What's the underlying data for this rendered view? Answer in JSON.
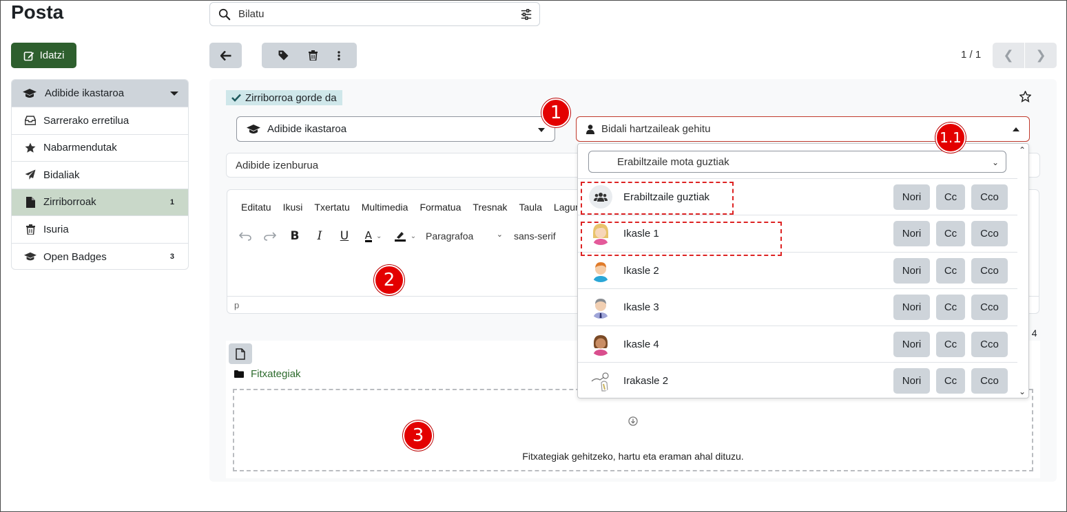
{
  "app": {
    "title": "Posta"
  },
  "search": {
    "placeholder": "Bilatu"
  },
  "compose": {
    "label": "Idatzi"
  },
  "sidebar": {
    "header": "Adibide ikastaroa",
    "items": [
      {
        "label": "Sarrerako erretilua",
        "icon": "inbox-icon",
        "count": ""
      },
      {
        "label": "Nabarmendutak",
        "icon": "star-icon",
        "count": ""
      },
      {
        "label": "Bidaliak",
        "icon": "send-icon",
        "count": ""
      },
      {
        "label": "Zirriborroak",
        "icon": "file-icon",
        "count": "1",
        "active": true
      },
      {
        "label": "Isuria",
        "icon": "trash-icon",
        "count": ""
      },
      {
        "label": "Open Badges",
        "icon": "graduation-cap-icon",
        "count": "3"
      }
    ]
  },
  "pager": {
    "text": "1 / 1"
  },
  "draft": {
    "saved_status": "Zirriborroa gorde da",
    "course": "Adibide ikastaroa",
    "recipients_placeholder": "Bidali hartzaileak gehitu",
    "subject": "Adibide izenburua"
  },
  "editor": {
    "menu": [
      "Editatu",
      "Ikusi",
      "Txertatu",
      "Multimedia",
      "Formatua",
      "Tresnak",
      "Taula",
      "Lagunt"
    ],
    "block_format": "Paragrafoa",
    "font_family": "sans-serif",
    "status_path": "p"
  },
  "right_count": ": 4",
  "files": {
    "folder": "Fitxategiak",
    "dropzone_text": "Fitxategiak gehitzeko, hartu eta eraman ahal dituzu."
  },
  "recipients_dropdown": {
    "filter": "Erabiltzaile mota guztiak",
    "buttons": {
      "to": "Nori",
      "cc": "Cc",
      "bcc": "Cco"
    },
    "rows": [
      {
        "name": "Erabiltzaile guztiak",
        "avatar": "users-icon"
      },
      {
        "name": "Ikasle 1",
        "avatar": "avatar-girl"
      },
      {
        "name": "Ikasle 2",
        "avatar": "avatar-boy"
      },
      {
        "name": "Ikasle 3",
        "avatar": "avatar-man"
      },
      {
        "name": "Ikasle 4",
        "avatar": "avatar-woman"
      },
      {
        "name": "Irakasle 2",
        "avatar": "avatar-teacher"
      }
    ]
  },
  "annotations": {
    "a1": "1",
    "a11": "1.1",
    "a2": "2",
    "a3": "3"
  },
  "colors": {
    "primary": "#2e5f2e",
    "badge": "#e30000",
    "active_item": "#c9d8c9"
  }
}
